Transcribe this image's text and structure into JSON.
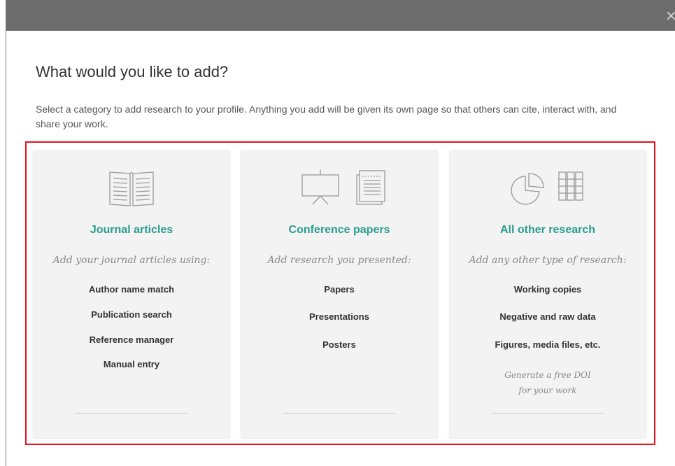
{
  "dialog": {
    "close_glyph": "×",
    "title": "What would you like to add?",
    "subtitle": "Select a category to add research to your profile. Anything you add will be given its own page so that others can cite, interact with, and share your work."
  },
  "cards": [
    {
      "title": "Journal articles",
      "subtitle": "Add your journal articles using:",
      "icons": [
        "open-book-icon"
      ],
      "options": [
        "Author name match",
        "Publication search",
        "Reference manager",
        "Manual entry"
      ]
    },
    {
      "title": "Conference papers",
      "subtitle": "Add research you presented:",
      "icons": [
        "presentation-board-icon",
        "document-icon"
      ],
      "options": [
        "Papers",
        "Presentations",
        "Posters"
      ]
    },
    {
      "title": "All other research",
      "subtitle": "Add any other type of research:",
      "icons": [
        "pie-chart-icon",
        "data-table-icon"
      ],
      "options": [
        "Working copies",
        "Negative and raw data",
        "Figures, media files, etc."
      ],
      "note_line1": "Generate a free DOI",
      "note_line2": "for your work"
    }
  ],
  "colors": {
    "topbar": "#6d6d6d",
    "accent": "#2a9d8f",
    "highlight_border": "#e3141b",
    "card_bg": "#f3f3f3"
  }
}
